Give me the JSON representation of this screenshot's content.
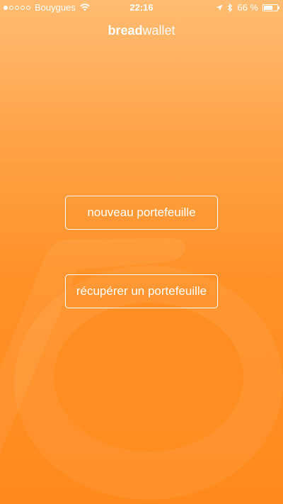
{
  "status_bar": {
    "carrier": "Bouygues",
    "time": "22:16",
    "battery_percent": "66 %",
    "battery_level": 0.66,
    "icons": [
      "signal-dots-icon",
      "wifi-icon",
      "location-arrow-icon",
      "bluetooth-icon",
      "battery-icon"
    ]
  },
  "app": {
    "logo_bold": "bread",
    "logo_light": "wallet"
  },
  "actions": {
    "new_wallet_label": "nouveau portefeuille",
    "recover_wallet_label": "récupérer un portefeuille"
  },
  "colors": {
    "gradient_top": "#ffbc72",
    "gradient_bottom": "#ff8a1c",
    "text": "#ffffff"
  }
}
